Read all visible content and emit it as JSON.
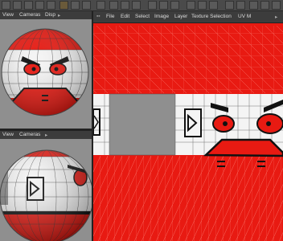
{
  "toolbar": {
    "view_label": "View",
    "cameras_label": "Cameras",
    "display_label": "Disp",
    "more_arrow": "▸"
  },
  "viewport_bottom": {
    "view_label": "View",
    "cameras_label": "Cameras",
    "more_arrow": "▸"
  },
  "uv_menu": {
    "items": [
      "File",
      "Edit",
      "Select",
      "Image",
      "Layer",
      "Texture Selection",
      "UV M"
    ],
    "more_arrow": "▸"
  },
  "colors": {
    "texture_red": "#e81a12",
    "viewport_bg": "#8f8f8f",
    "panel_dark": "#3c3c3c"
  }
}
